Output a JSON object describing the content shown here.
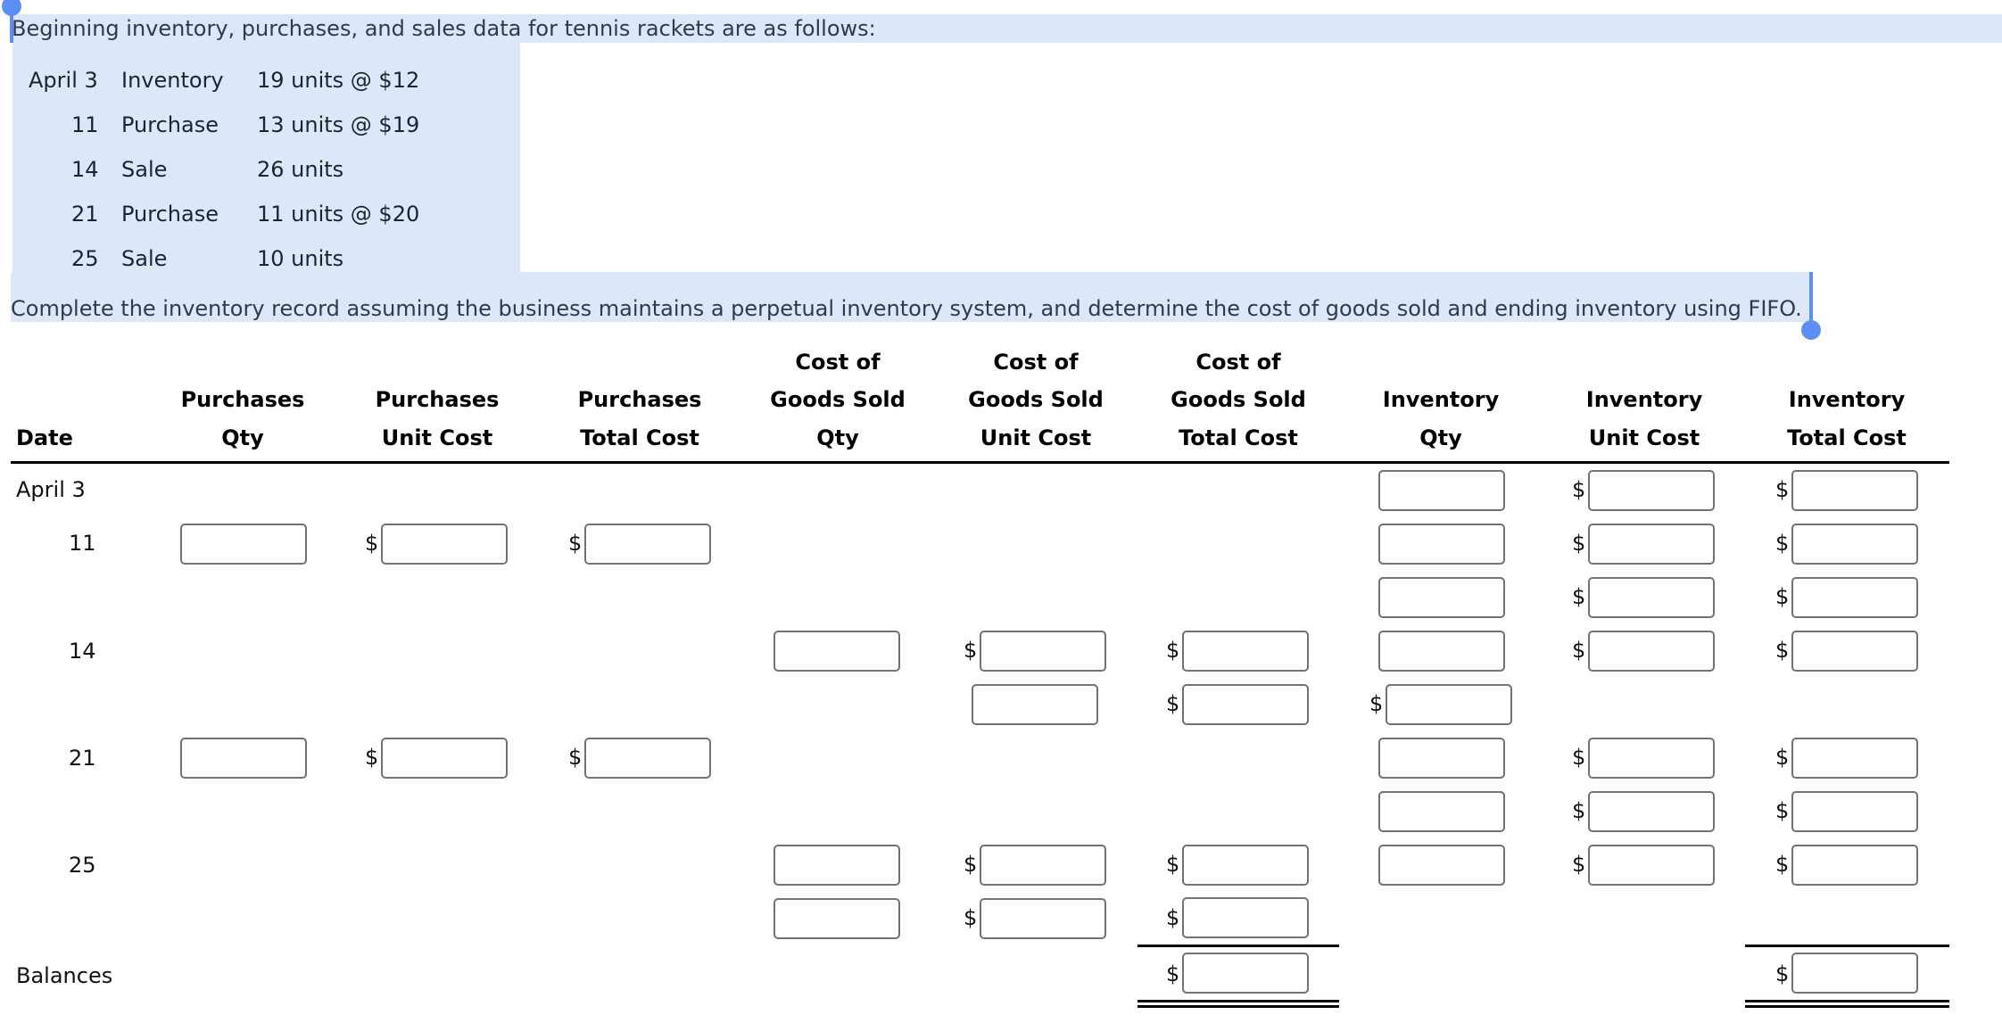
{
  "intro_text": "Beginning inventory, purchases, and sales data for tennis rackets are as follows:",
  "given_data": [
    {
      "date": "April 3",
      "type": "Inventory",
      "detail": "19 units @ $12"
    },
    {
      "date": "11",
      "type": "Purchase",
      "detail": "13 units @ $19"
    },
    {
      "date": "14",
      "type": "Sale",
      "detail": "26 units"
    },
    {
      "date": "21",
      "type": "Purchase",
      "detail": "11 units @ $20"
    },
    {
      "date": "25",
      "type": "Sale",
      "detail": "10 units"
    }
  ],
  "instruction_text": "Complete the inventory record assuming the business maintains a perpetual inventory system, and determine the cost of goods sold and ending inventory using FIFO.",
  "table": {
    "headers": {
      "date": [
        "Date"
      ],
      "purchases_qty": [
        "Purchases",
        "Qty"
      ],
      "purchases_unit_cost": [
        "Purchases",
        "Unit Cost"
      ],
      "purchases_total_cost": [
        "Purchases",
        "Total Cost"
      ],
      "cogs_qty": [
        "Cost of",
        "Goods Sold",
        "Qty"
      ],
      "cogs_unit_cost": [
        "Cost of",
        "Goods Sold",
        "Unit Cost"
      ],
      "cogs_total_cost": [
        "Cost of",
        "Goods Sold",
        "Total Cost"
      ],
      "inventory_qty": [
        "Inventory",
        "Qty"
      ],
      "inventory_unit_cost": [
        "Inventory",
        "Unit Cost"
      ],
      "inventory_total_cost": [
        "Inventory",
        "Total Cost"
      ]
    },
    "row_labels": {
      "apr3": "April 3",
      "apr11": "11",
      "apr14": "14",
      "apr21": "21",
      "apr25": "25",
      "balances": "Balances"
    },
    "currency_symbol": "$",
    "input_values": {
      "default": ""
    }
  },
  "colors": {
    "selection_highlight": "#dce8fa",
    "selection_handle": "#5b8ff5",
    "input_border": "#727272"
  }
}
